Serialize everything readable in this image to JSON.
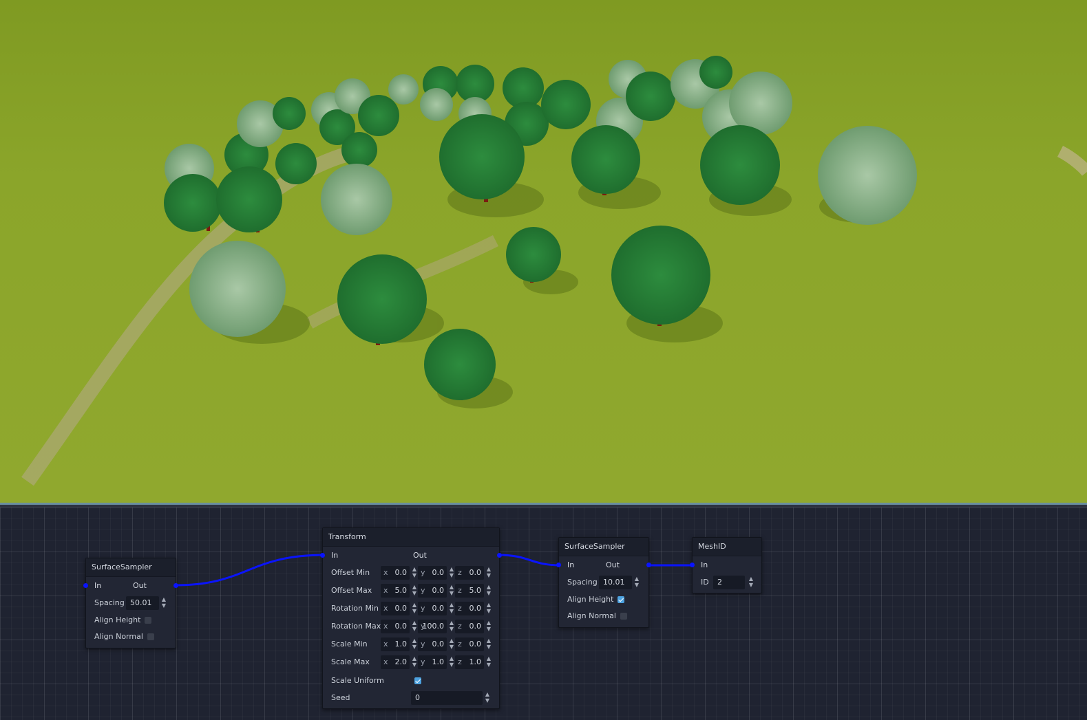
{
  "viewport": {
    "sky_color": "#8a9a2a",
    "ground_color": "#8ea52a",
    "tree_colors": [
      "#2f8a3a",
      "#8fb890",
      "#3c9a48"
    ]
  },
  "graph": {
    "background": "#1f2331",
    "wire_color": "#0a14ff",
    "nodes": {
      "sampler1": {
        "title": "SurfaceSampler",
        "in_label": "In",
        "out_label": "Out",
        "spacing_label": "Spacing",
        "spacing_value": "50.01",
        "align_height_label": "Align Height",
        "align_height": false,
        "align_normal_label": "Align Normal",
        "align_normal": false
      },
      "transform": {
        "title": "Transform",
        "in_label": "In",
        "out_label": "Out",
        "rows": [
          {
            "label": "Offset Min",
            "x": "0.0",
            "y": "0.0",
            "z": "0.0"
          },
          {
            "label": "Offset Max",
            "x": "5.0",
            "y": "0.0",
            "z": "5.0"
          },
          {
            "label": "Rotation Min",
            "x": "0.0",
            "y": "0.0",
            "z": "0.0"
          },
          {
            "label": "Rotation Max",
            "x": "0.0",
            "y": "100.0",
            "z": "0.0"
          },
          {
            "label": "Scale Min",
            "x": "1.0",
            "y": "0.0",
            "z": "0.0"
          },
          {
            "label": "Scale Max",
            "x": "2.0",
            "y": "1.0",
            "z": "1.0"
          }
        ],
        "axis_x": "x",
        "axis_y": "y",
        "axis_z": "z",
        "scale_uniform_label": "Scale Uniform",
        "scale_uniform": true,
        "seed_label": "Seed",
        "seed_value": "0"
      },
      "sampler2": {
        "title": "SurfaceSampler",
        "in_label": "In",
        "out_label": "Out",
        "spacing_label": "Spacing",
        "spacing_value": "10.01",
        "align_height_label": "Align Height",
        "align_height": true,
        "align_normal_label": "Align Normal",
        "align_normal": false
      },
      "meshid": {
        "title": "MeshID",
        "in_label": "In",
        "id_label": "ID",
        "id_value": "2"
      }
    }
  }
}
